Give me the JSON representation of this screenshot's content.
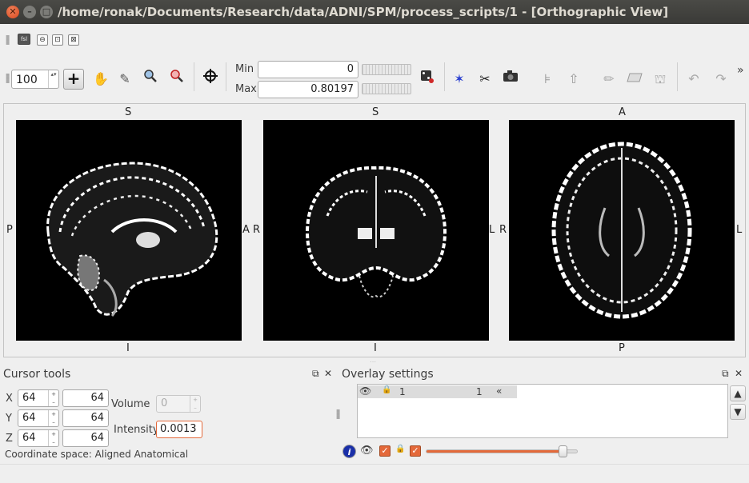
{
  "window": {
    "title": "/home/ronak/Documents/Research/data/ADNI/SPM/process_scripts/1 - [Orthographic View]",
    "controls": {
      "close": "✕",
      "minimize": "–",
      "maximize": "□"
    }
  },
  "subtoolbar": {
    "app_icon": "fsl-icon",
    "icon_labels": [
      "fsl",
      "⊖",
      "⊡",
      "⊠"
    ]
  },
  "toolbar": {
    "zoom_value": "100",
    "zoom_arrows": "▴▾",
    "min_label": "Min",
    "min_value": "0",
    "max_label": "Max",
    "max_value": "0.80197",
    "icons": [
      "crosshair-add-icon",
      "hand-pan-icon",
      "pencil-icon",
      "zoom-icon",
      "zoom-reset-icon",
      "locate-target-icon",
      "dice-icon",
      "cursor-axis-icon",
      "clip-icon",
      "camera-icon",
      "fit-icon",
      "flip-icon",
      "draw-pencil-icon",
      "eraser-icon",
      "fill-icon",
      "undo-icon",
      "redo-icon",
      "more-icon"
    ],
    "overflow": "»"
  },
  "views": {
    "sagittal": {
      "top": "S",
      "bottom": "I",
      "left": "P",
      "right": "A"
    },
    "coronal": {
      "top": "S",
      "bottom": "I",
      "left": "R",
      "right": "L"
    },
    "axial": {
      "top": "A",
      "bottom": "P",
      "left": "R",
      "right": "L"
    }
  },
  "cursor_tools": {
    "title": "Cursor tools",
    "x_label": "X",
    "x_voxel": "64",
    "x_world": "64",
    "y_label": "Y",
    "y_voxel": "64",
    "y_world": "64",
    "z_label": "Z",
    "z_voxel": "64",
    "z_world": "64",
    "volume_label": "Volume",
    "volume_value": "0",
    "intensity_label": "Intensity",
    "intensity_value": "0.0013",
    "coordinate_space": "Coordinate space: Aligned Anatomical",
    "spin_plus": "+",
    "spin_minus": "–"
  },
  "overlay_settings": {
    "title": "Overlay settings",
    "rows": [
      {
        "name": "1",
        "volume": "1",
        "arrow": "«"
      }
    ],
    "up": "🡅",
    "down": "🡇",
    "info": "i",
    "opacity": 0.9
  },
  "panel_controls": {
    "undock": "⧉",
    "close": "✕"
  },
  "colors": {
    "accent": "#e4693a",
    "titlebar": "#3c3b37",
    "close_btn": "#df4a16"
  }
}
